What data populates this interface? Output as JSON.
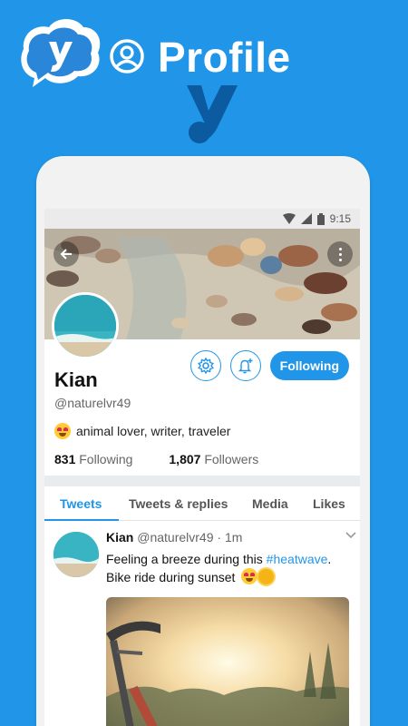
{
  "promo": {
    "title": "Profile"
  },
  "status_bar": {
    "time": "9:15"
  },
  "profile": {
    "name": "Kian",
    "handle": "@naturelvr49",
    "bio": "animal lover, writer, traveler",
    "following_count": "831",
    "following_label": "Following",
    "followers_count": "1,807",
    "followers_label": "Followers",
    "follow_button_label": "Following"
  },
  "tabs": [
    {
      "label": "Tweets",
      "active": true
    },
    {
      "label": "Tweets & replies",
      "active": false
    },
    {
      "label": "Media",
      "active": false
    },
    {
      "label": "Likes",
      "active": false
    }
  ],
  "tweet": {
    "name": "Kian",
    "handle": "@naturelvr49",
    "separator": "·",
    "time": "1m",
    "text_before_hashtag": "Feeling a breeze during this ",
    "hashtag": "#heatwave",
    "text_after_hashtag": ".",
    "line2": "Bike ride during sunset"
  },
  "colors": {
    "brand_blue": "#2196e8",
    "background": "#2196e8"
  },
  "icons": [
    "app-logo-icon",
    "profile-person-icon",
    "y-mark-icon",
    "wifi-icon",
    "signal-icon",
    "battery-icon",
    "back-arrow-icon",
    "more-vertical-icon",
    "settings-gear-icon",
    "add-notification-icon",
    "heart-eyes-emoji-icon",
    "sun-emoji-icon",
    "chevron-down-icon"
  ]
}
